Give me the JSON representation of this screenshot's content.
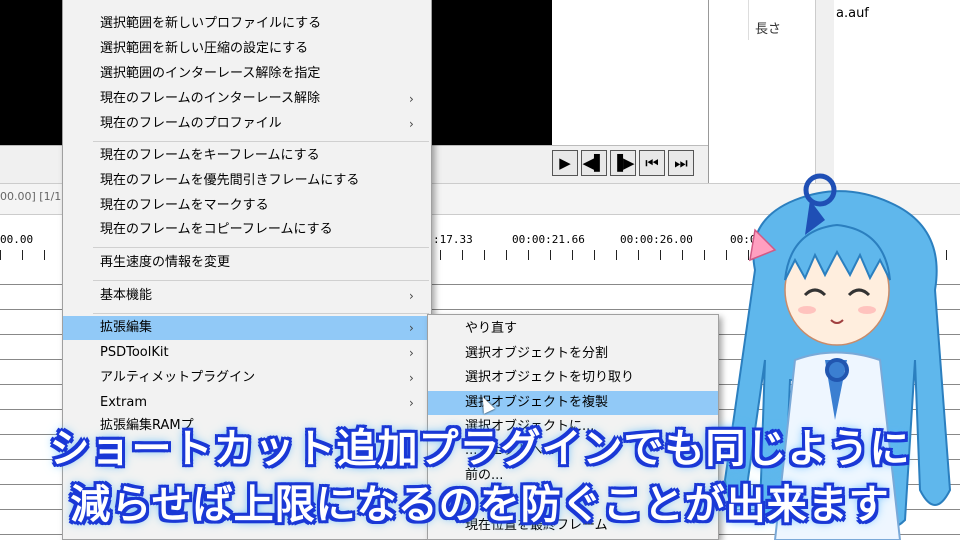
{
  "timeline": {
    "position_readout": "00.00] [1/1]",
    "ticks": [
      "00.00",
      ":17.33",
      "00:00:21.66",
      "00:00:26.00",
      "00:0"
    ]
  },
  "file_panel": {
    "column_length": "長さ",
    "file_name": "a.auf"
  },
  "transport": [
    "play",
    "prev-frame",
    "next-frame",
    "first-frame",
    "last-frame"
  ],
  "menu": {
    "items": [
      {
        "label": "選択範囲を新しいプロファイルにする",
        "submenu": false
      },
      {
        "label": "選択範囲を新しい圧縮の設定にする",
        "submenu": false
      },
      {
        "label": "選択範囲のインターレース解除を指定",
        "submenu": false
      },
      {
        "label": "現在のフレームのインターレース解除",
        "submenu": true
      },
      {
        "label": "現在のフレームのプロファイル",
        "submenu": true
      },
      {
        "label": "現在のフレームをキーフレームにする",
        "submenu": false
      },
      {
        "label": "現在のフレームを優先間引きフレームにする",
        "submenu": false
      },
      {
        "label": "現在のフレームをマークする",
        "submenu": false
      },
      {
        "label": "現在のフレームをコピーフレームにする",
        "submenu": false
      },
      {
        "label": "再生速度の情報を変更",
        "submenu": false
      },
      {
        "label": "基本機能",
        "submenu": true
      },
      {
        "label": "拡張編集",
        "submenu": true,
        "highlighted": true
      },
      {
        "label": "PSDToolKit",
        "submenu": true
      },
      {
        "label": "アルティメットプラグイン",
        "submenu": true
      },
      {
        "label": "Extram",
        "submenu": true
      },
      {
        "label": "拡張編集RAMプ",
        "submenu": false
      }
    ],
    "arrow": "›"
  },
  "submenu": {
    "items": [
      {
        "label": "やり直す"
      },
      {
        "label": "選択オブジェクトを分割"
      },
      {
        "label": "選択オブジェクトを切り取り"
      },
      {
        "label": "選択オブジェクトを複製",
        "highlighted": true
      },
      {
        "label": "選択オブジェクトに..."
      },
      {
        "label": "...ジェクトへ..."
      },
      {
        "label": "前の..."
      },
      {
        "label": "..."
      },
      {
        "label": "現在位置を最終フレーム"
      }
    ]
  },
  "caption": {
    "line1": "ショートカット追加プラグインでも同じように",
    "line2": "減らせば上限になるのを防ぐことが出来ます"
  },
  "colors": {
    "highlight": "#91c9f7",
    "caption_outline": "#1a38d6",
    "caption_fill": "#ffffff",
    "character_hair": "#5fb7ec"
  }
}
